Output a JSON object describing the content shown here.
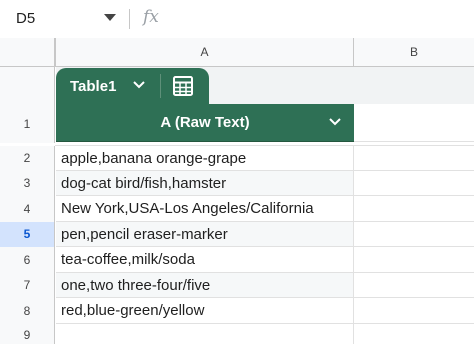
{
  "formula_bar": {
    "name_box": "D5",
    "fx_label": "fx"
  },
  "columns": {
    "a": "A",
    "b": "B"
  },
  "table": {
    "name": "Table1",
    "header_label": "A (Raw Text)",
    "accent_color": "#2e7055"
  },
  "rows": {
    "numbers": [
      "1",
      "2",
      "3",
      "4",
      "5",
      "6",
      "7",
      "8",
      "9"
    ],
    "selected_row": "5"
  },
  "data": [
    "apple,banana orange-grape",
    "dog-cat bird/fish,hamster",
    "New York,USA-Los Angeles/California",
    "pen,pencil eraser-marker",
    "tea-coffee,milk/soda",
    "one,two three-four/five",
    "red,blue-green/yellow",
    ""
  ]
}
